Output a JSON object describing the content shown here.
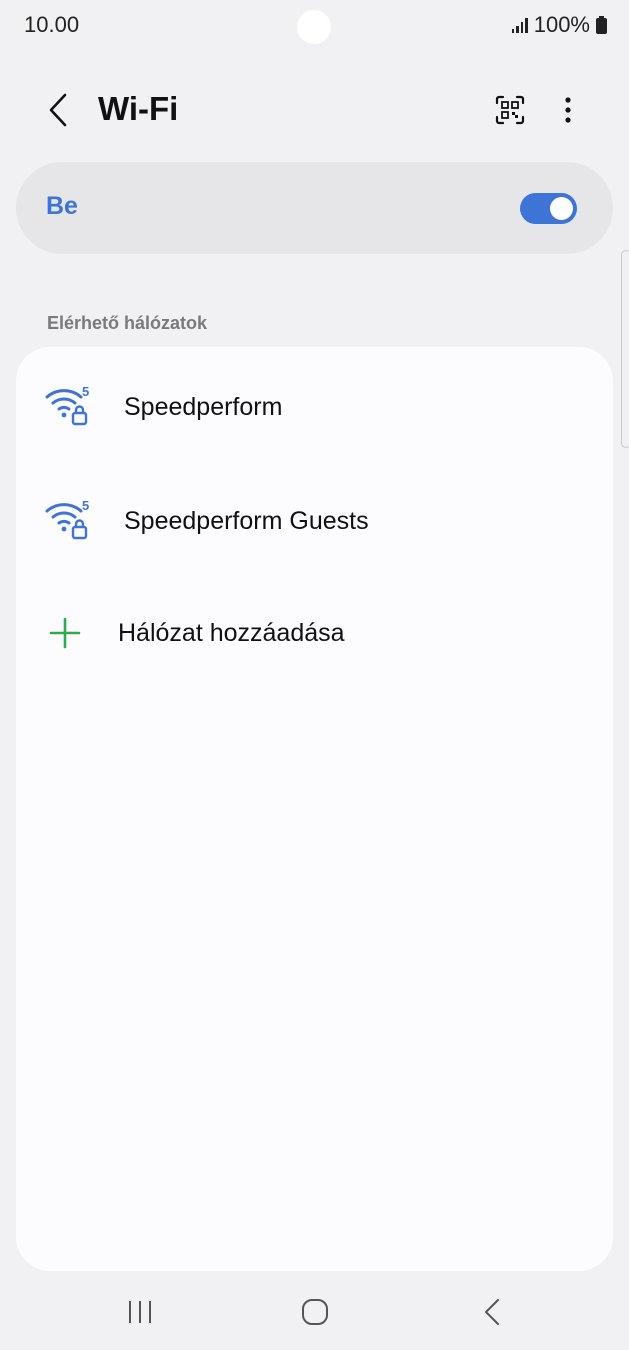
{
  "status_bar": {
    "time": "10.00",
    "battery": "100%"
  },
  "header": {
    "title": "Wi-Fi"
  },
  "wifi_toggle": {
    "label": "Be",
    "state": "on",
    "accent_color": "#3e74d6"
  },
  "networks": {
    "section_title": "Elérhető hálózatok",
    "items": [
      {
        "name": "Speedperform",
        "band": "5",
        "secured": true,
        "icon": "wifi-5ghz-lock-icon"
      },
      {
        "name": "Speedperform Guests",
        "band": "5",
        "secured": true,
        "icon": "wifi-5ghz-lock-icon"
      }
    ],
    "add_network_label": "Hálózat hozzáadása",
    "add_icon_color": "#2eaa4f"
  },
  "nav_bar": {
    "icons": [
      "recents-icon",
      "home-icon",
      "back-icon"
    ]
  }
}
